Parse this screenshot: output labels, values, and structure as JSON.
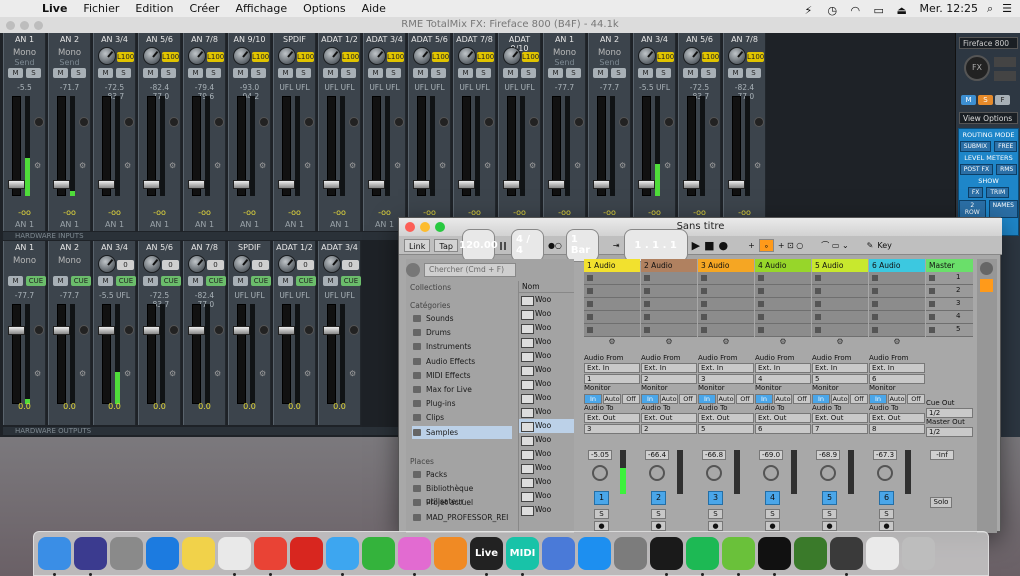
{
  "menubar": {
    "app_name": "Live",
    "items": [
      "Fichier",
      "Edition",
      "Créer",
      "Affichage",
      "Options",
      "Aide"
    ],
    "clock": "Mer. 12:25"
  },
  "totalmix": {
    "title": "RME TotalMix FX: Fireface 800 (B4F) - 44.1k",
    "inputs": [
      {
        "name": "AN 1",
        "mode": "Mono",
        "sub2": "Send",
        "level": "-5.5",
        "vol": "-oo",
        "foot": "AN 1",
        "meter": 0.38
      },
      {
        "name": "AN 2",
        "mode": "Mono",
        "sub2": "Send",
        "level": "-71.7",
        "vol": "-oo",
        "foot": "AN 1",
        "meter": 0.05
      },
      {
        "name": "AN 3/4",
        "pan": "L100",
        "level": "-72.5 -83.7",
        "vol": "-oo",
        "foot": "AN 1"
      },
      {
        "name": "AN 5/6",
        "pan": "L100",
        "level": "-82.4 -77.0",
        "vol": "-oo",
        "foot": "AN 1"
      },
      {
        "name": "AN 7/8",
        "pan": "L100",
        "level": "-79.4 -79.6",
        "vol": "-oo",
        "foot": "AN 1"
      },
      {
        "name": "AN 9/10",
        "pan": "L100",
        "level": "-93.0 -94.2",
        "vol": "-oo",
        "foot": "AN 1"
      },
      {
        "name": "SPDIF",
        "pan": "L100",
        "level": "UFL UFL",
        "vol": "-oo",
        "foot": "AN 1"
      },
      {
        "name": "ADAT 1/2",
        "pan": "L100",
        "level": "UFL UFL",
        "vol": "-oo",
        "foot": "AN 1"
      },
      {
        "name": "ADAT 3/4",
        "pan": "L100",
        "level": "UFL UFL",
        "vol": "-oo",
        "foot": "AN 1"
      },
      {
        "name": "ADAT 5/6",
        "pan": "L100",
        "level": "UFL UFL",
        "vol": "-oo",
        "foot": "AN 1"
      },
      {
        "name": "ADAT 7/8",
        "pan": "L100",
        "level": "UFL UFL",
        "vol": "-oo",
        "foot": "AN 1"
      },
      {
        "name": "ADAT 9/10",
        "pan": "L100",
        "level": "UFL UFL",
        "vol": "-oo",
        "foot": "AN 1"
      },
      {
        "name": "AN 1",
        "mode": "Mono",
        "sub2": "Send",
        "level": "-77.7",
        "vol": "-oo",
        "foot": "AN 1"
      },
      {
        "name": "AN 2",
        "mode": "Mono",
        "sub2": "Send",
        "level": "-77.7",
        "vol": "-oo",
        "foot": "AN 1"
      },
      {
        "name": "AN 3/4",
        "pan": "L100",
        "level": "-5.5 UFL",
        "vol": "-oo",
        "foot": "AN 1",
        "meter": 0.32
      },
      {
        "name": "AN 5/6",
        "pan": "L100",
        "level": "-72.5 -83.7",
        "vol": "-oo",
        "foot": "AN 1"
      },
      {
        "name": "AN 7/8",
        "pan": "L100",
        "level": "-82.4 -77.0",
        "vol": "-oo",
        "foot": "AN 1"
      }
    ],
    "outputs": [
      {
        "name": "AN 1",
        "mode": "Mono",
        "level": "-77.7",
        "vol": "0.0",
        "meter": 0.05
      },
      {
        "name": "AN 2",
        "mode": "Mono",
        "level": "-77.7",
        "vol": "0.0"
      },
      {
        "name": "AN 3/4",
        "pan": "0",
        "level": "-5.5 UFL",
        "vol": "0.0",
        "meter": 0.32
      },
      {
        "name": "AN 5/6",
        "pan": "0",
        "level": "-72.5 -83.7",
        "vol": "0.0"
      },
      {
        "name": "AN 7/8",
        "pan": "0",
        "level": "-82.4 -77.0",
        "vol": "0.0"
      },
      {
        "name": "SPDIF",
        "pan": "0",
        "level": "UFL UFL",
        "vol": "0.0"
      },
      {
        "name": "ADAT 1/2",
        "pan": "0",
        "level": "UFL UFL",
        "vol": "0.0"
      },
      {
        "name": "ADAT 3/4",
        "pan": "0",
        "level": "UFL UFL",
        "vol": "0.0"
      }
    ],
    "labels": {
      "hw_inputs": "HARDWARE INPUTS",
      "hw_outputs": "HARDWARE OUTPUTS"
    },
    "side": {
      "device": "Fireface 800",
      "fx": "FX",
      "view_options": "View Options",
      "routing_mode": "ROUTING MODE",
      "submix": "SUBMIX",
      "free": "FREE",
      "level_meters": "LEVEL METERS",
      "post_fx": "POST FX",
      "rms": "RMS",
      "show": "SHOW",
      "fx_btn": "FX",
      "trim": "TRIM",
      "2row": "2 ROW",
      "names": "NAMES"
    }
  },
  "live": {
    "title": "Sans titre",
    "control": {
      "link": "Link",
      "tap": "Tap",
      "tempo": "120.00",
      "sig": "4 / 4",
      "quant": "1 Bar",
      "position": "1 .  1 .  1",
      "key": "Key"
    },
    "browser": {
      "search_placeholder": "Chercher (Cmd + F)",
      "collections": "Collections",
      "categories": "Catégories",
      "cat_items": [
        "Sounds",
        "Drums",
        "Instruments",
        "Audio Effects",
        "MIDI Effects",
        "Max for Live",
        "Plug-ins",
        "Clips",
        "Samples"
      ],
      "places": "Places",
      "place_items": [
        "Packs",
        "Bibliothèque utilisateur",
        "Projet actuel",
        "MAD_PROFESSOR_REI"
      ],
      "col_header": "Nom",
      "files": [
        "Woo",
        "Woo",
        "Woo",
        "Woo",
        "Woo",
        "Woo",
        "Woo",
        "Woo",
        "Woo",
        "Woo",
        "Woo",
        "Woo",
        "Woo",
        "Woo",
        "Woo",
        "Woo"
      ]
    },
    "tracks": [
      {
        "name": "1 Audio",
        "color": "#f2e12e",
        "in": "Ext. In",
        "ch": "1",
        "out": "Ext. Out",
        "och": "3",
        "vol": "-5.05",
        "num": "1",
        "meter": 0.6
      },
      {
        "name": "2 Audio",
        "color": "#b08160",
        "in": "Ext. In",
        "ch": "2",
        "out": "Ext. Out",
        "och": "2",
        "vol": "-66.4",
        "num": "2",
        "meter": 0.0
      },
      {
        "name": "3 Audio",
        "color": "#f5a623",
        "in": "Ext. In",
        "ch": "3",
        "out": "Ext. Out",
        "och": "5",
        "vol": "-66.8",
        "num": "3",
        "meter": 0.0
      },
      {
        "name": "4 Audio",
        "color": "#97d62a",
        "in": "Ext. In",
        "ch": "4",
        "out": "Ext. Out",
        "och": "6",
        "vol": "-69.0",
        "num": "4",
        "meter": 0.0
      },
      {
        "name": "5 Audio",
        "color": "#c8e82e",
        "in": "Ext. In",
        "ch": "5",
        "out": "Ext. Out",
        "och": "7",
        "vol": "-68.9",
        "num": "5",
        "meter": 0.0
      },
      {
        "name": "6 Audio",
        "color": "#3cc8e0",
        "in": "Ext. In",
        "ch": "6",
        "out": "Ext. Out",
        "och": "8",
        "vol": "-67.3",
        "num": "6",
        "meter": 0.0
      }
    ],
    "io_labels": {
      "from": "Audio From",
      "monitor": "Monitor",
      "to": "Audio To",
      "in": "In",
      "auto": "Auto",
      "off": "Off"
    },
    "master": {
      "name": "Master",
      "cue_out": "Cue Out",
      "cue_val": "1/2",
      "master_out": "Master Out",
      "master_val": "1/2",
      "vol": "-Inf",
      "solo": "Solo",
      "scenes": [
        "1",
        "2",
        "3",
        "4",
        "5"
      ]
    }
  },
  "dock": {
    "apps": [
      {
        "name": "finder-icon",
        "color": "#3a8ee6",
        "label": ""
      },
      {
        "name": "siri-icon",
        "color": "#3b3b8f",
        "label": ""
      },
      {
        "name": "launchpad-icon",
        "color": "#8a8a8a",
        "label": ""
      },
      {
        "name": "safari-icon",
        "color": "#1c7be0",
        "label": ""
      },
      {
        "name": "notes-icon",
        "color": "#f1d24a",
        "label": ""
      },
      {
        "name": "photos-icon",
        "color": "#e9e9e9",
        "label": ""
      },
      {
        "name": "chrome-icon",
        "color": "#e94335",
        "label": ""
      },
      {
        "name": "opera-icon",
        "color": "#d8261f",
        "label": ""
      },
      {
        "name": "messages-icon",
        "color": "#3da6f0",
        "label": ""
      },
      {
        "name": "facetime-icon",
        "color": "#34b33c",
        "label": ""
      },
      {
        "name": "itunes-icon",
        "color": "#e26bd1",
        "label": ""
      },
      {
        "name": "ibooks-icon",
        "color": "#f08a24",
        "label": ""
      },
      {
        "name": "live-icon",
        "color": "#222222",
        "label": "Live"
      },
      {
        "name": "midi-icon",
        "color": "#18c3a8",
        "label": "MIDI"
      },
      {
        "name": "network-icon",
        "color": "#4a7ad8",
        "label": ""
      },
      {
        "name": "appstore-icon",
        "color": "#1d8ff0",
        "label": ""
      },
      {
        "name": "sysprefs-icon",
        "color": "#7c7c7c",
        "label": ""
      },
      {
        "name": "piano-icon",
        "color": "#1a1a1a",
        "label": ""
      },
      {
        "name": "spotify-icon",
        "color": "#1db954",
        "label": ""
      },
      {
        "name": "utorrent-icon",
        "color": "#6ac13a",
        "label": ""
      },
      {
        "name": "unknown-icon",
        "color": "#111111",
        "label": ""
      },
      {
        "name": "mic-icon",
        "color": "#3a7a2a",
        "label": ""
      },
      {
        "name": "totalmix-icon",
        "color": "#3a3a3a",
        "label": ""
      },
      {
        "name": "preview-icon",
        "color": "#eaeaea",
        "label": ""
      },
      {
        "name": "trash-icon",
        "color": "#bdbdbd",
        "label": ""
      }
    ]
  }
}
